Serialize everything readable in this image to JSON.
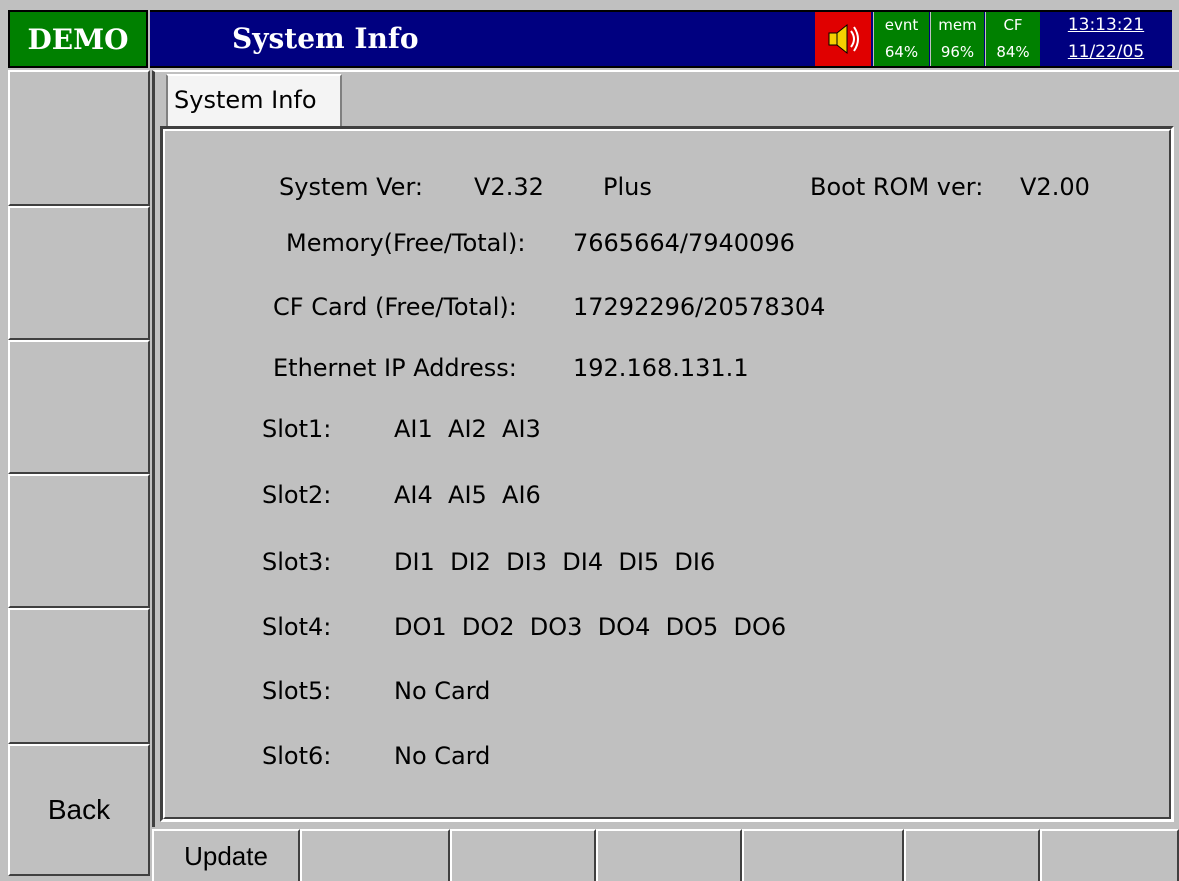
{
  "header": {
    "mode": "DEMO",
    "title": "System Info",
    "status": [
      {
        "label": "evnt",
        "value": "64%"
      },
      {
        "label": "mem",
        "value": "96%"
      },
      {
        "label": "CF",
        "value": "84%"
      }
    ],
    "time": "13:13:21",
    "date": "11/22/05"
  },
  "sidebar": {
    "keys": [
      "",
      "",
      "",
      "",
      "",
      "Back"
    ]
  },
  "tab": {
    "label": "System Info"
  },
  "info": {
    "system_ver_label": "System Ver:",
    "system_ver_value": "V2.32",
    "edition": "Plus",
    "boot_rom_label": "Boot ROM ver:",
    "boot_rom_value": "V2.00",
    "rows": [
      {
        "label": "Memory(Free/Total):",
        "value": "7665664/7940096"
      },
      {
        "label": "CF Card (Free/Total):",
        "value": "17292296/20578304"
      },
      {
        "label": "Ethernet IP Address:",
        "value": "192.168.131.1"
      }
    ],
    "slots": [
      {
        "label": "Slot1:",
        "value": "AI1  AI2  AI3"
      },
      {
        "label": "Slot2:",
        "value": "AI4  AI5  AI6"
      },
      {
        "label": "Slot3:",
        "value": "DI1  DI2  DI3  DI4  DI5  DI6"
      },
      {
        "label": "Slot4:",
        "value": "DO1  DO2  DO3  DO4  DO5  DO6"
      },
      {
        "label": "Slot5:",
        "value": "No Card"
      },
      {
        "label": "Slot6:",
        "value": "No Card"
      }
    ]
  },
  "bottom": {
    "keys": [
      "Update",
      "",
      "",
      "",
      "",
      "",
      ""
    ]
  },
  "colors": {
    "mode_bg": "#008000",
    "title_bg": "#000080",
    "alarm_bg": "#e00000",
    "panel_bg": "#c0c0c0"
  },
  "icons": {
    "alarm": "speaker-icon"
  }
}
